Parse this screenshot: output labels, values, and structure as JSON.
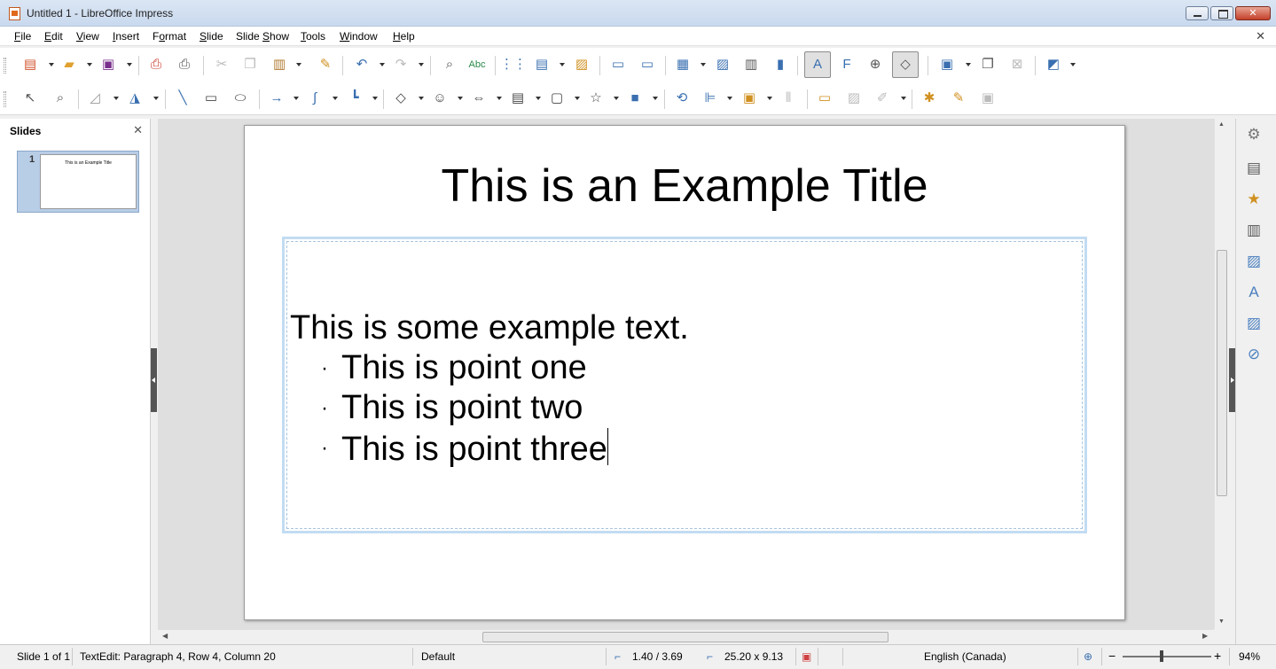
{
  "window": {
    "title": "Untitled 1 - LibreOffice Impress"
  },
  "menu": {
    "items": [
      {
        "u": "F",
        "rest": "ile"
      },
      {
        "u": "E",
        "rest": "dit"
      },
      {
        "u": "V",
        "rest": "iew"
      },
      {
        "u": "I",
        "rest": "nsert"
      },
      {
        "u": "F",
        "rest": "ormat",
        "prefix": ""
      },
      {
        "u": "S",
        "rest": "lide"
      },
      {
        "u": "S",
        "rest": "lide Show"
      },
      {
        "u": "T",
        "rest": "ools"
      },
      {
        "u": "W",
        "rest": "indow"
      },
      {
        "u": "H",
        "rest": "elp"
      }
    ],
    "close_glyph": "✕"
  },
  "slides_pane": {
    "title": "Slides",
    "close_glyph": "✕",
    "thumbnails": [
      {
        "number": "1",
        "title": "This is an Example Title"
      }
    ]
  },
  "slide": {
    "title": "This is an Example Title",
    "body": "This is some example text.",
    "bullet_glyph": "·",
    "bullets": [
      "This is point one",
      "This is point two",
      "This is point three"
    ]
  },
  "statusbar": {
    "slide_info": "Slide 1 of 1",
    "edit_info": "TextEdit: Paragraph 4, Row 4, Column 20",
    "master": "Default",
    "position": "1.40 / 3.69",
    "size": "25.20 x 9.13",
    "language": "English (Canada)",
    "zoom": "94%",
    "zoom_minus": "−",
    "zoom_plus": "+"
  },
  "colors": {
    "accent": "#3a6fb0",
    "textbox_border": "#c2dcf2",
    "workspace_bg": "#dfdfdf"
  }
}
